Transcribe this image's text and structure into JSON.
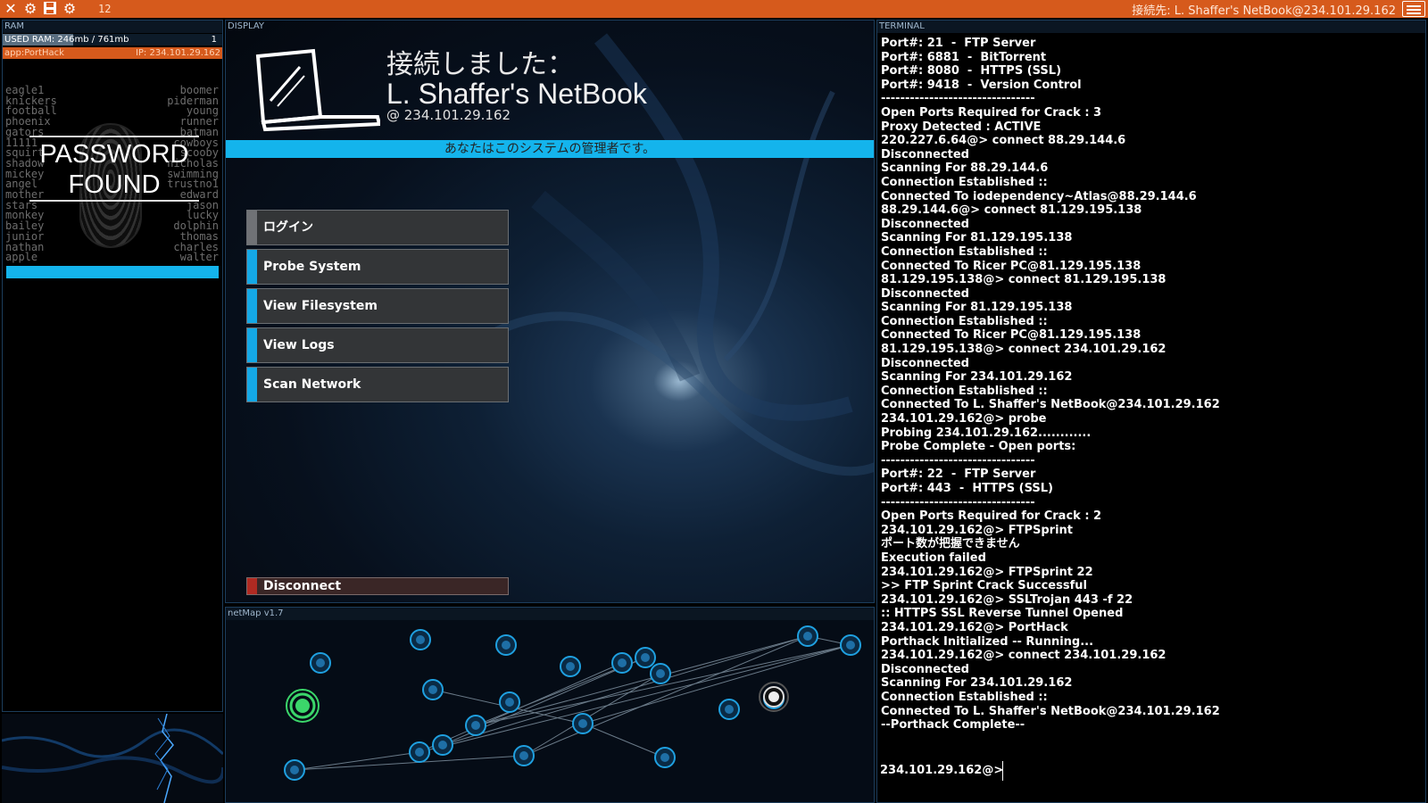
{
  "topbar": {
    "count": "12",
    "connection": "接続先: L. Shaffer's NetBook@234.101.29.162"
  },
  "ram": {
    "title": "RAM",
    "used_label": "USED RAM: 246mb / 761mb",
    "used_fraction": 0.32,
    "process_count": "1",
    "app": {
      "name": "app:PortHack",
      "ip": "IP: 234.101.29.162",
      "status_line1": "PASSWORD",
      "status_line2": "FOUND",
      "passwords_left": [
        "eagle1",
        "knickers",
        "football",
        "phoenix",
        "gators",
        "11111",
        "squirt",
        "shadow",
        "mickey",
        "angel",
        "mother",
        "stars",
        "monkey",
        "bailey",
        "junior",
        "nathan",
        "apple"
      ],
      "passwords_right": [
        "boomer",
        "piderman",
        "young",
        "runner",
        "batman",
        "cowboys",
        "scooby",
        "nicholas",
        "swimming",
        "trustno1",
        "edward",
        "jason",
        "lucky",
        "dolphin",
        "thomas",
        "charles",
        "walter"
      ]
    }
  },
  "display": {
    "title": "DISPLAY",
    "connected_label": "接続しました：",
    "computer_name": "L. Shaffer's NetBook",
    "ip_line": "@  234.101.29.162",
    "admin_notice": "あなたはこのシステムの管理者です。",
    "buttons": {
      "login": "ログイン",
      "probe": "Probe System",
      "filesystem": "View Filesystem",
      "logs": "View Logs",
      "scan": "Scan Network",
      "disconnect": "Disconnect"
    }
  },
  "netmap": {
    "title": "netMap v1.7"
  },
  "terminal": {
    "title": "TERMINAL",
    "lines": [
      "Port#: 21  -  FTP Server",
      "Port#: 6881  -  BitTorrent",
      "Port#: 8080  -  HTTPS (SSL)",
      "Port#: 9418  -  Version Control",
      "--------------------------------",
      "Open Ports Required for Crack : 3",
      "Proxy Detected : ACTIVE",
      "220.227.6.64@> connect 88.29.144.6",
      "Disconnected",
      "Scanning For 88.29.144.6",
      "Connection Established ::",
      "Connected To iodependency~Atlas@88.29.144.6",
      "88.29.144.6@> connect 81.129.195.138",
      "Disconnected",
      "Scanning For 81.129.195.138",
      "Connection Established ::",
      "Connected To Ricer PC@81.129.195.138",
      "81.129.195.138@> connect 81.129.195.138",
      "Disconnected",
      "Scanning For 81.129.195.138",
      "Connection Established ::",
      "Connected To Ricer PC@81.129.195.138",
      "81.129.195.138@> connect 234.101.29.162",
      "Disconnected",
      "Scanning For 234.101.29.162",
      "Connection Established ::",
      "Connected To L. Shaffer's NetBook@234.101.29.162",
      "234.101.29.162@> probe",
      "Probing 234.101.29.162............",
      "Probe Complete - Open ports:",
      "--------------------------------",
      "Port#: 22  -  FTP Server",
      "Port#: 443  -  HTTPS (SSL)",
      "--------------------------------",
      "Open Ports Required for Crack : 2",
      "234.101.29.162@> FTPSprint",
      "ポート数が把握できません",
      "Execution failed",
      "234.101.29.162@> FTPSprint 22",
      ">> FTP Sprint Crack Successful",
      "234.101.29.162@> SSLTrojan 443 -f 22",
      ":: HTTPS SSL Reverse Tunnel Opened",
      "234.101.29.162@> PortHack",
      "Porthack Initialized -- Running...",
      "234.101.29.162@> connect 234.101.29.162",
      "Disconnected",
      "Scanning For 234.101.29.162",
      "Connection Established ::",
      "Connected To L. Shaffer's NetBook@234.101.29.162",
      "--Porthack Complete--"
    ],
    "prompt": "234.101.29.162@>"
  },
  "colors": {
    "accent": "#14b4ec",
    "topbar": "#d65a1c",
    "danger": "#b02a22"
  }
}
